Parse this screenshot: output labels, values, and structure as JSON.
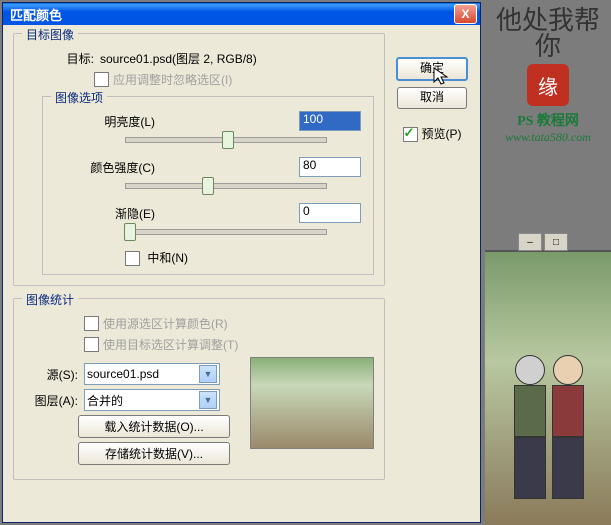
{
  "dialog": {
    "title": "匹配颜色",
    "close": "X"
  },
  "buttons": {
    "ok": "确定",
    "cancel": "取消",
    "preview_label": "预览(P)"
  },
  "target_image": {
    "legend": "目标图像",
    "target_label": "目标:",
    "target_value": "source01.psd(图层 2, RGB/8)",
    "ignore_selection": "应用调整时忽略选区(I)"
  },
  "image_options": {
    "legend": "图像选项",
    "brightness_label": "明亮度(L)",
    "brightness_value": "100",
    "intensity_label": "颜色强度(C)",
    "intensity_value": "80",
    "fade_label": "渐隐(E)",
    "fade_value": "0",
    "neutralize": "中和(N)"
  },
  "image_stats": {
    "legend": "图像统计",
    "use_source_sel": "使用源选区计算颜色(R)",
    "use_target_sel": "使用目标选区计算调整(T)",
    "source_label": "源(S):",
    "source_value": "source01.psd",
    "layer_label": "图层(A):",
    "layer_value": "合并的",
    "load_stats": "载入统计数据(O)...",
    "save_stats": "存储统计数据(V)..."
  },
  "watermark": {
    "chars": "他处我帮你",
    "seal": "缘",
    "ps": "PS 教程网",
    "url": "www.tata580.com"
  },
  "winbtns": {
    "min": "–",
    "max": "□"
  }
}
